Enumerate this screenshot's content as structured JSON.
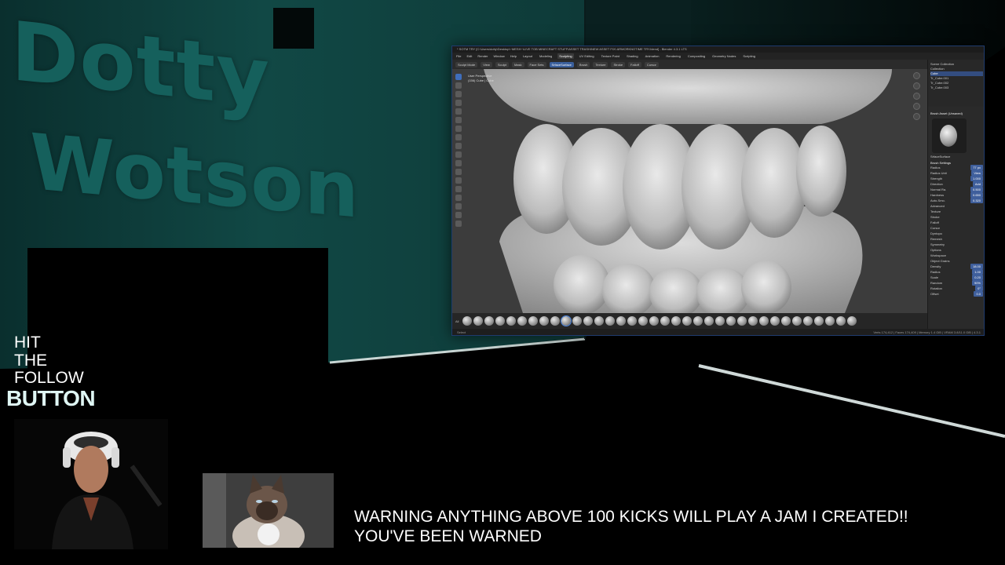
{
  "overlay": {
    "logo_line_1": "Dotty",
    "logo_line_2": "Wotson",
    "follow_lines": [
      "HIT",
      "THE",
      "FOLLOW",
      "BUTTON"
    ],
    "warning_line_1": "WARNING ANYTHING ABOVE 100 KICKS WILL PLAY A JAM I CREATED!!",
    "warning_line_2": "YOU'VE BEEN WARNED",
    "colors": {
      "teal_wall": "#0f3d3b",
      "logo_text": "#15605c",
      "follow_accent": "#dff6f4"
    }
  },
  "blender": {
    "title": "* SOTM TRY [C:\\Users\\dotty\\Desktop\\~MESH~\\LIVE TOB MINECRAFT STUFF\\ASSET TRASH\\NEW ASSET FIX\\ ARMORKNOTIME TRY.blend] - Blender 4.3.1 LTS",
    "menus": [
      "File",
      "Edit",
      "Render",
      "Window",
      "Help"
    ],
    "workspaces": [
      "Layout",
      "Modeling",
      "Sculpting",
      "UV Editing",
      "Texture Paint",
      "Shading",
      "Animation",
      "Rendering",
      "Compositing",
      "Geometry Nodes",
      "Scripting"
    ],
    "active_workspace": "Sculpting",
    "toolbar_items": [
      "Sculpt Mode",
      "View",
      "Sculpt",
      "Mask",
      "Face Sets",
      "Brush",
      "Texture",
      "Stroke",
      "Falloff",
      "Cursor"
    ],
    "active_brush_chip": "SrfaceSurface",
    "viewport_info": [
      "User Perspective",
      "(156) Cube | Cube"
    ],
    "brush_bar_label": "All",
    "brush_count": 36,
    "active_brush_index": 9,
    "status_left": "Select",
    "status_right": "Verts 174,412 | Faces 174,409 | Memory 1.4 GiB | VRAM 3.8/11.0 GiB | 4.3.1",
    "outliner": {
      "title": "Scene Collection",
      "rows": [
        "Collection",
        "Cube",
        "Tr_Cube.001",
        "Tr_Cube.002",
        "Tr_Cube.003"
      ],
      "selected_index": 1
    },
    "properties": {
      "brush_header": "Brush Asset (Unsaved)",
      "brush_name": "SrfaceSurface",
      "section_settings": "Brush Settings",
      "rows": [
        {
          "label": "Radius",
          "value": "77 px"
        },
        {
          "label": "Radius Unit",
          "value": "View"
        },
        {
          "label": "Strength",
          "value": "1.000"
        },
        {
          "label": "Direction",
          "value": "Add"
        },
        {
          "label": "Normal Ra.",
          "value": "0.500"
        },
        {
          "label": "Hardness",
          "value": "0.650"
        },
        {
          "label": "Auto-Smo.",
          "value": "0.320"
        }
      ],
      "collapsed_sections": [
        "Advanced",
        "Texture",
        "Stroke",
        "Falloff",
        "Cursor",
        "Dyntopo",
        "Remesh",
        "Symmetry",
        "Options",
        "Workspace",
        "Object Grains"
      ],
      "bottom_rows": [
        {
          "label": "Density",
          "value": "18.00"
        },
        {
          "label": "Radius",
          "value": "1.00"
        },
        {
          "label": "Scale",
          "value": "0.20"
        },
        {
          "label": "Random",
          "value": "90%"
        },
        {
          "label": "Rotation",
          "value": "0°"
        },
        {
          "label": "Offset",
          "value": "0.0"
        }
      ]
    }
  }
}
